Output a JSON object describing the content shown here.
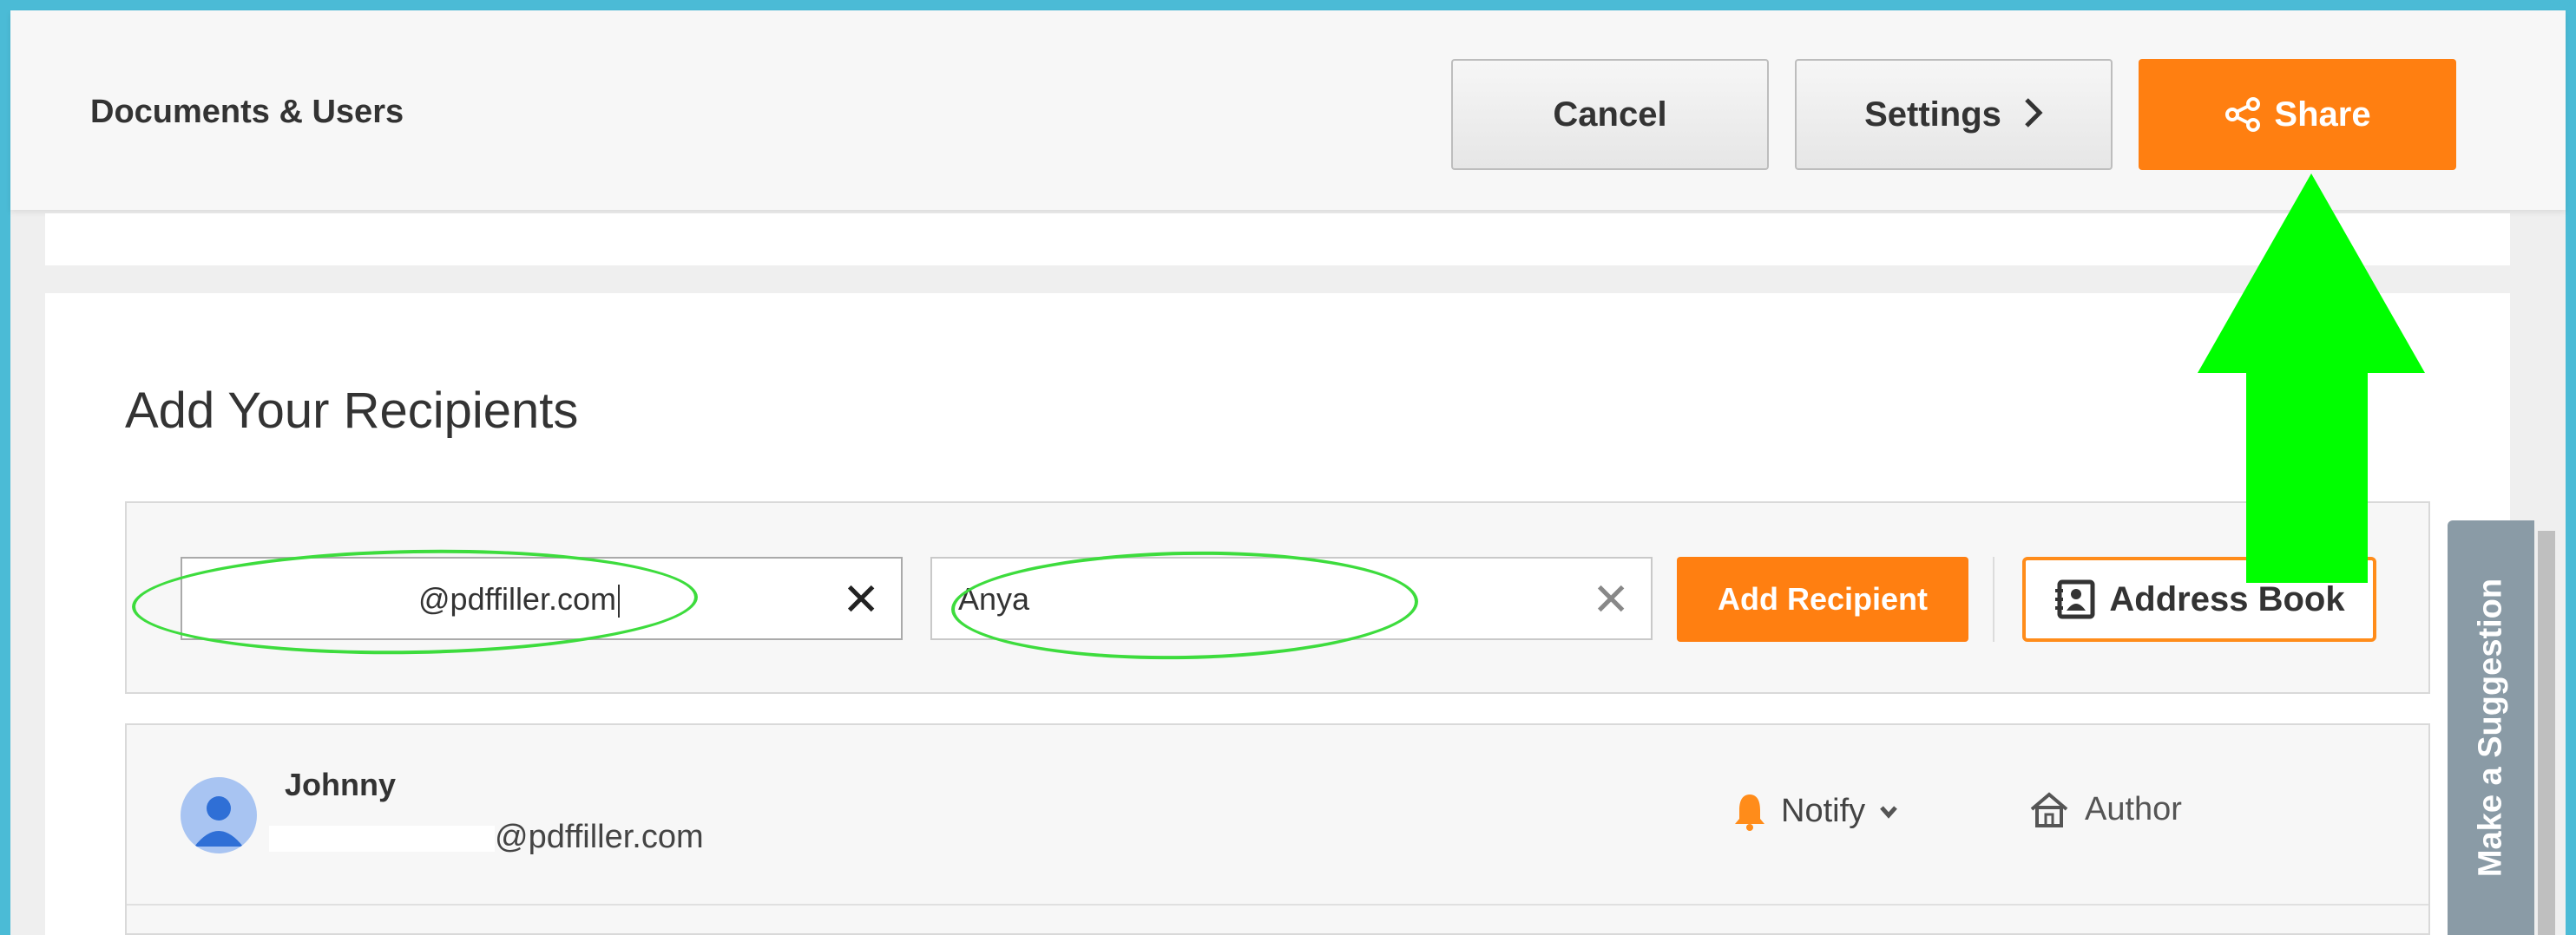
{
  "header": {
    "title": "Documents & Users",
    "cancel_label": "Cancel",
    "settings_label": "Settings",
    "share_label": "Share"
  },
  "recipients": {
    "heading": "Add Your Recipients",
    "email_value": "@pdffiller.com",
    "name_value": "Anya",
    "add_label": "Add Recipient",
    "address_book_label": "Address Book"
  },
  "recipient_list": [
    {
      "name": "Johnny",
      "email": "@pdffiller.com",
      "notify_label": "Notify",
      "role_label": "Author"
    }
  ],
  "side_tab": {
    "label": "Make a Suggestion"
  },
  "colors": {
    "accent": "#ff7f11",
    "frame": "#4bbbd6",
    "annotation": "#00ff00",
    "suggest_tab": "#8a9ba6"
  },
  "icons": [
    "share-icon",
    "chevron-right-icon",
    "clear-icon",
    "address-book-icon",
    "bell-icon",
    "chevron-down-icon",
    "home-icon",
    "user-avatar-icon",
    "arrow-up-icon"
  ]
}
